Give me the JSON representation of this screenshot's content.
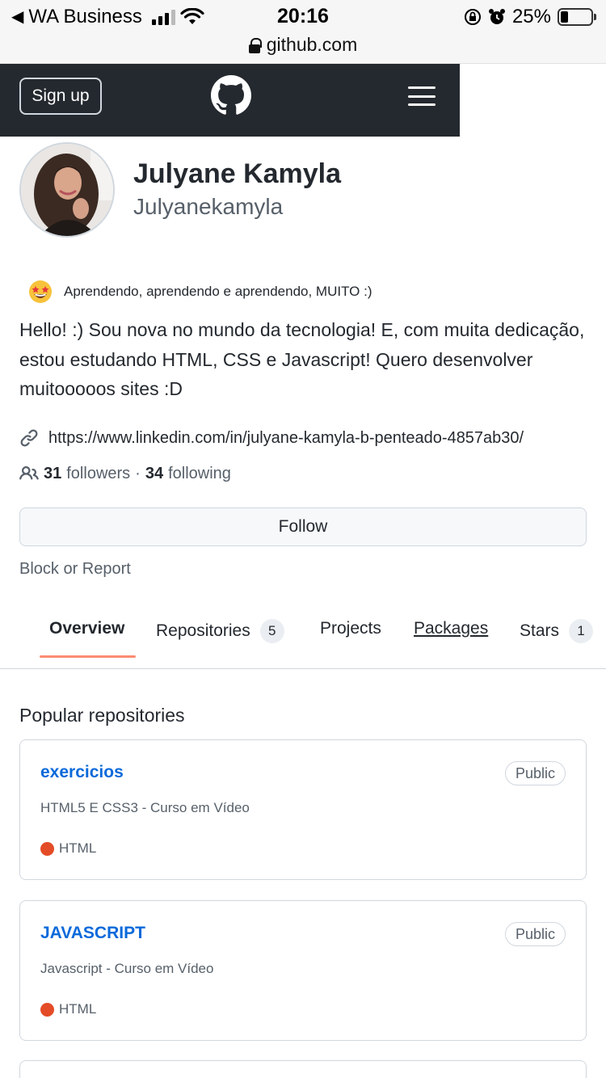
{
  "status_bar": {
    "back_app": "WA Business",
    "time": "20:16",
    "battery": "25%"
  },
  "browser": {
    "url": "github.com"
  },
  "header": {
    "sign_up": "Sign up"
  },
  "profile": {
    "name": "Julyane Kamyla",
    "username": "Julyanekamyla",
    "status": "Aprendendo, aprendendo e aprendendo, MUITO :)",
    "bio": "Hello! :) Sou nova no mundo da tecnologia! E, com muita dedicação, estou estudando HTML, CSS e Javascript! Quero desenvolver muitooooos sites :D",
    "link": "https://www.linkedin.com/in/julyane-kamyla-b-penteado-4857ab30/",
    "followers_count": "31",
    "followers_label": "followers",
    "separator": "·",
    "following_count": "34",
    "following_label": "following",
    "follow_button": "Follow",
    "block_report": "Block or Report"
  },
  "tabs": [
    {
      "label": "Overview",
      "active": true
    },
    {
      "label": "Repositories",
      "count": "5"
    },
    {
      "label": "Projects"
    },
    {
      "label": "Packages"
    },
    {
      "label": "Stars",
      "count": "1"
    }
  ],
  "popular": {
    "title": "Popular repositories",
    "repos": [
      {
        "name": "exercicios",
        "visibility": "Public",
        "description": "HTML5 E CSS3 - Curso em Vídeo",
        "language": "HTML",
        "language_color": "#e34c26"
      },
      {
        "name": "JAVASCRIPT",
        "visibility": "Public",
        "description": "Javascript - Curso em Vídeo",
        "language": "HTML",
        "language_color": "#e34c26"
      }
    ]
  },
  "colors": {
    "header_bg": "#24292f",
    "link_blue": "#0969da",
    "tab_underline": "#fd8c73"
  }
}
